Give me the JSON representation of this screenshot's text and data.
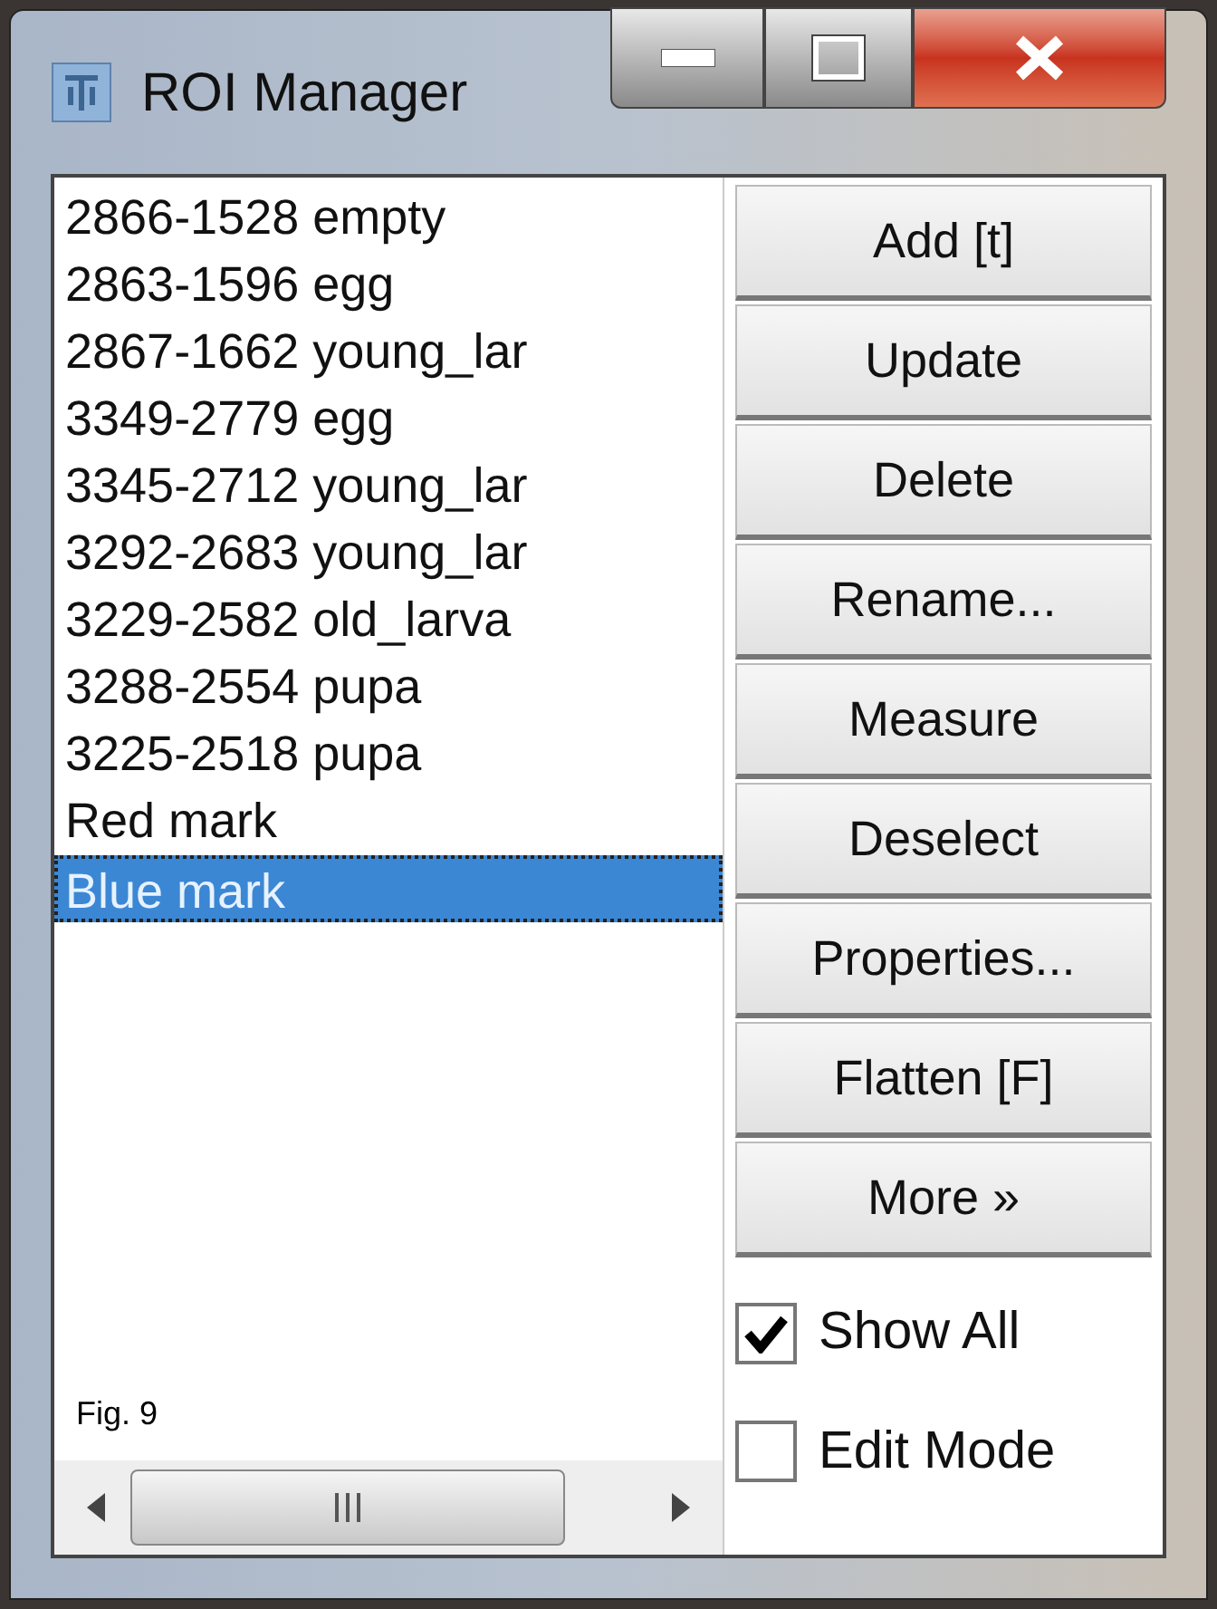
{
  "window": {
    "title": "ROI Manager"
  },
  "list": {
    "items": [
      {
        "label": "2866-1528 empty",
        "selected": false
      },
      {
        "label": "2863-1596 egg",
        "selected": false
      },
      {
        "label": "2867-1662 young_lar",
        "selected": false
      },
      {
        "label": "3349-2779 egg",
        "selected": false
      },
      {
        "label": "3345-2712 young_lar",
        "selected": false
      },
      {
        "label": "3292-2683 young_lar",
        "selected": false
      },
      {
        "label": "3229-2582 old_larva",
        "selected": false
      },
      {
        "label": "3288-2554 pupa",
        "selected": false
      },
      {
        "label": "3225-2518 pupa",
        "selected": false
      },
      {
        "label": "Red mark",
        "selected": false
      },
      {
        "label": "Blue mark",
        "selected": true
      }
    ]
  },
  "caption": "Fig. 9",
  "buttons": [
    "Add [t]",
    "Update",
    "Delete",
    "Rename...",
    "Measure",
    "Deselect",
    "Properties...",
    "Flatten [F]",
    "More »"
  ],
  "checkboxes": [
    {
      "label": "Show All",
      "checked": true
    },
    {
      "label": "Edit Mode",
      "checked": false
    }
  ]
}
